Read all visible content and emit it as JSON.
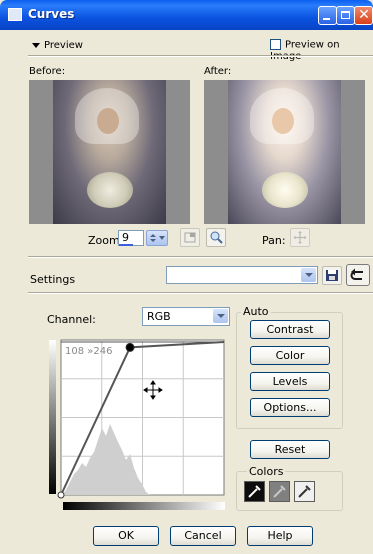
{
  "window": {
    "title": "Curves"
  },
  "preview": {
    "toggle_label": "Preview",
    "preview_on_image_label": "Preview on Image",
    "preview_on_image_checked": false,
    "before_label": "Before:",
    "after_label": "After:"
  },
  "zoom": {
    "label": "Zoom:",
    "value": "9"
  },
  "pan": {
    "label": "Pan:"
  },
  "settings": {
    "label": "Settings",
    "preset_value": ""
  },
  "channel": {
    "label": "Channel:",
    "value": "RGB"
  },
  "curve": {
    "readout": "108 »246",
    "input_range": [
      0,
      255
    ],
    "output_range": [
      0,
      255
    ],
    "points": [
      [
        0,
        0
      ],
      [
        108,
        246
      ],
      [
        255,
        255
      ]
    ]
  },
  "auto": {
    "title": "Auto",
    "contrast_label": "Contrast",
    "color_label": "Color",
    "levels_label": "Levels",
    "options_label": "Options..."
  },
  "reset_label": "Reset",
  "colors": {
    "title": "Colors",
    "black_point_icon": "eyedropper-black-icon",
    "gray_point_icon": "eyedropper-gray-icon",
    "white_point_icon": "eyedropper-white-icon"
  },
  "footer": {
    "ok_label": "OK",
    "cancel_label": "Cancel",
    "help_label": "Help"
  },
  "colors_theme": {
    "titlebar": "#0a53e0",
    "dialog_bg": "#ece9d8",
    "curve_line": "#555555"
  }
}
